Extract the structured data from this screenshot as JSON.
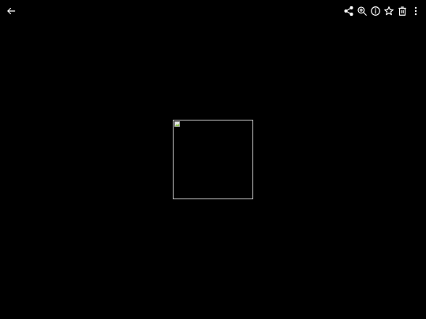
{
  "toolbar": {
    "back_icon": "arrow-back-icon",
    "actions": [
      {
        "icon": "share-icon"
      },
      {
        "icon": "zoom-in-icon"
      },
      {
        "icon": "info-icon"
      },
      {
        "icon": "star-outline-icon"
      },
      {
        "icon": "delete-icon"
      },
      {
        "icon": "more-vert-icon"
      }
    ]
  },
  "viewer": {
    "background": "#000000",
    "image_state": "broken-image-placeholder"
  },
  "colors": {
    "icon": "#ffffff",
    "frame_border": "#bdbdbd"
  }
}
